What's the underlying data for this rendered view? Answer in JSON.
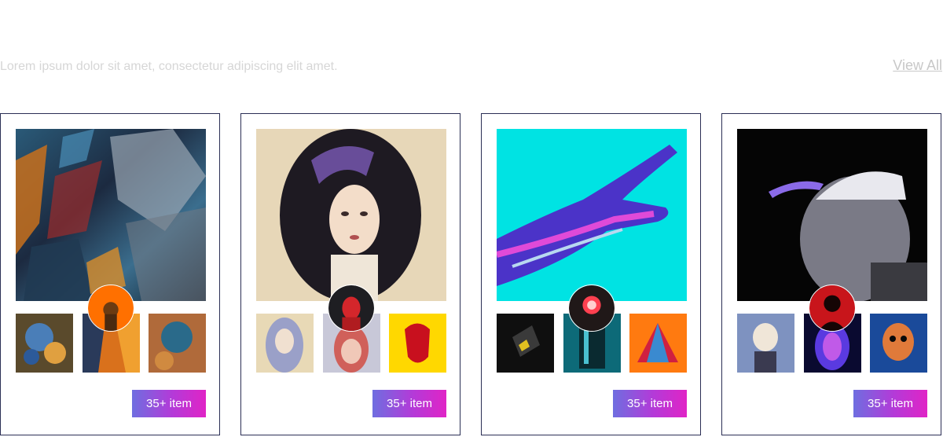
{
  "header": {
    "subtitle": "Lorem ipsum dolor sit amet, consectetur adipiscing elit amet.",
    "view_all": "View All"
  },
  "collections": [
    {
      "badge": "35+ item",
      "art": "abstract-shards",
      "accent": "#ff7a00"
    },
    {
      "badge": "35+ item",
      "art": "watercolor-woman",
      "accent": "#d4262b"
    },
    {
      "badge": "35+ item",
      "art": "chrome-hand",
      "accent": "#00e0e0"
    },
    {
      "badge": "35+ item",
      "art": "cap-figure",
      "accent": "#c8151b"
    }
  ]
}
